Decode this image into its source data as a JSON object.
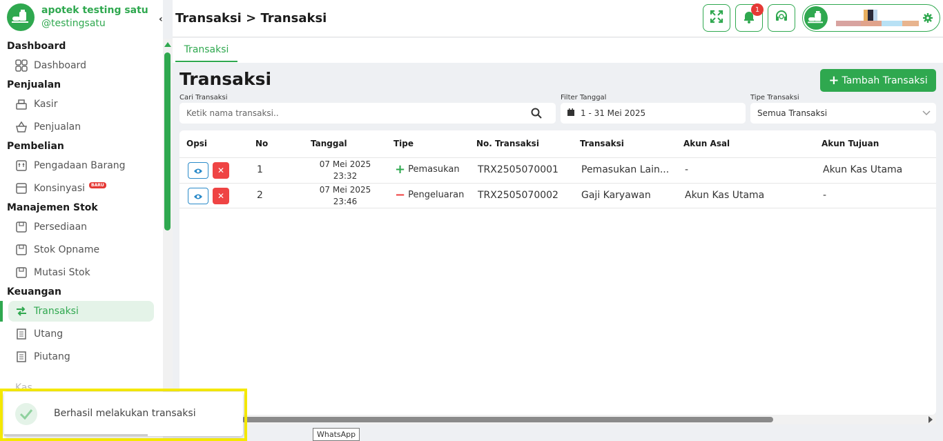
{
  "brand": {
    "name": "apotek testing satu",
    "handle": "@testingsatu"
  },
  "sidebar": {
    "collapse_glyph": "‹",
    "sections": [
      {
        "title": "Dashboard",
        "items": [
          {
            "label": "Dashboard",
            "icon": "grid-icon"
          }
        ]
      },
      {
        "title": "Penjualan",
        "items": [
          {
            "label": "Kasir",
            "icon": "cash-register-icon"
          },
          {
            "label": "Penjualan",
            "icon": "basket-icon"
          }
        ]
      },
      {
        "title": "Pembelian",
        "items": [
          {
            "label": "Pengadaan Barang",
            "icon": "box-in-icon"
          },
          {
            "label": "Konsinyasi",
            "icon": "box-icon",
            "badge": "BARU"
          }
        ]
      },
      {
        "title": "Manajemen Stok",
        "items": [
          {
            "label": "Persediaan",
            "icon": "box-icon"
          },
          {
            "label": "Stok Opname",
            "icon": "box-icon"
          },
          {
            "label": "Mutasi Stok",
            "icon": "box-icon"
          }
        ]
      },
      {
        "title": "Keuangan",
        "items": [
          {
            "label": "Transaksi",
            "icon": "transfer-icon",
            "active": true
          },
          {
            "label": "Utang",
            "icon": "receipt-icon"
          },
          {
            "label": "Piutang",
            "icon": "receipt-icon"
          }
        ]
      }
    ],
    "partial_item": "Kas"
  },
  "header": {
    "breadcrumb": "Transaksi > Transaksi",
    "notification_count": "1"
  },
  "tabs": [
    {
      "label": "Transaksi",
      "active": true
    }
  ],
  "main": {
    "title": "Transaksi",
    "add_button": "Tambah Transaksi",
    "filters": {
      "search": {
        "label": "Cari Transaksi",
        "placeholder": "Ketik nama transaksi.."
      },
      "date": {
        "label": "Filter Tanggal",
        "value": "1 - 31 Mei 2025"
      },
      "type": {
        "label": "Tipe Transaksi",
        "value": "Semua Transaksi"
      }
    },
    "table": {
      "headers": [
        "Opsi",
        "No",
        "Tanggal",
        "Tipe",
        "No. Transaksi",
        "Transaksi",
        "Akun Asal",
        "Akun Tujuan"
      ],
      "rows": [
        {
          "no": "1",
          "date": "07 Mei 2025",
          "time": "23:32",
          "type": "Pemasukan",
          "type_sign": "+",
          "trx_no": "TRX2505070001",
          "trx": "Pemasukan Lain...",
          "from": "-",
          "to": "Akun Kas Utama"
        },
        {
          "no": "2",
          "date": "07 Mei 2025",
          "time": "23:46",
          "type": "Pengeluaran",
          "type_sign": "−",
          "trx_no": "TRX2505070002",
          "trx": "Gaji Karyawan",
          "from": "Akun Kas Utama",
          "to": "-"
        }
      ]
    }
  },
  "toast": {
    "message": "Berhasil melakukan transaksi"
  },
  "tooltip": "WhatsApp",
  "colors": {
    "primary": "#2fa84f",
    "danger": "#ef4444",
    "info": "#2a8ac9",
    "highlight": "#f5e900"
  }
}
